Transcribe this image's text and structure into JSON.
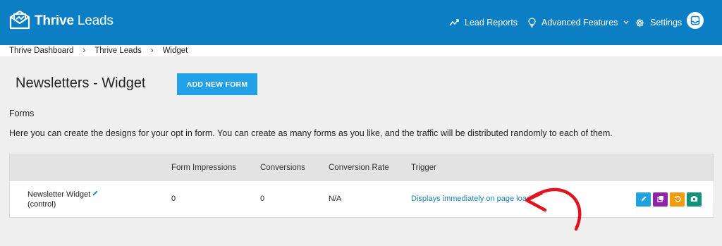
{
  "header": {
    "brand_bold": "Thrive",
    "brand_rest": " Leads",
    "nav": {
      "lead_reports": "Lead Reports",
      "advanced_features": "Advanced Features",
      "settings": "Settings"
    }
  },
  "breadcrumb": {
    "items": [
      "Thrive Dashboard",
      "Thrive Leads",
      "Widget"
    ],
    "separator": "›"
  },
  "page": {
    "title": "Newsletters - Widget",
    "add_button": "ADD NEW FORM",
    "section_label": "Forms",
    "description": "Here you can create the designs for your opt in form. You can create as many forms as you like, and the traffic will be distributed randomly to each of them."
  },
  "table": {
    "columns": [
      "Form Impressions",
      "Conversions",
      "Conversion Rate",
      "Trigger"
    ],
    "rows": [
      {
        "name": "Newsletter Widget",
        "variant": "(control)",
        "impressions": "0",
        "conversions": "0",
        "conversion_rate": "N/A",
        "trigger": "Displays immediately on page load"
      }
    ]
  },
  "actions": {
    "edit": {
      "icon": "pencil-icon",
      "color": "#1ea3e0"
    },
    "duplicate": {
      "icon": "copy-icon",
      "color": "#8e24aa"
    },
    "reset": {
      "icon": "undo-icon",
      "color": "#f39a0f"
    },
    "snapshot": {
      "icon": "camera-icon",
      "color": "#13927b"
    }
  },
  "colors": {
    "header_bg": "#0c7fc4",
    "button_bg": "#22a0e8",
    "link": "#1a7fc1",
    "annotation_arrow": "#e0141e"
  }
}
